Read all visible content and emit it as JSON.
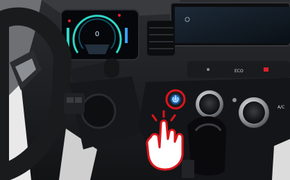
{
  "cluster": {
    "speed_readout": "0"
  },
  "climate_panel": {
    "eco_label": "ECO",
    "ac_label": "A/C"
  },
  "start_button": {
    "icon": "power-icon",
    "highlight_color": "#d9161c"
  },
  "overlay": {
    "icon": "tap-hand-icon",
    "outline_color": "#d9161c"
  },
  "colors": {
    "cluster_accent": "#2fd6c8",
    "start_glow": "#3aa0ff",
    "warning_red": "#e0202a"
  }
}
